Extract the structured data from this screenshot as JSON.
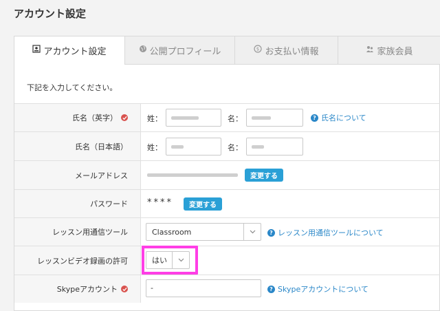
{
  "page_title": "アカウント設定",
  "tabs": [
    {
      "label": "アカウント設定",
      "icon": "account-icon"
    },
    {
      "label": "公開プロフィール",
      "icon": "globe-icon"
    },
    {
      "label": "お支払い情報",
      "icon": "coin-icon"
    },
    {
      "label": "家族会員",
      "icon": "family-icon"
    }
  ],
  "intro": "下記を入力してください。",
  "rows": {
    "name_en": {
      "label": "氏名（英字）",
      "last_prefix": "姓：",
      "first_prefix": "名：",
      "help": "氏名について"
    },
    "name_jp": {
      "label": "氏名（日本語）",
      "last_prefix": "姓：",
      "first_prefix": "名："
    },
    "email": {
      "label": "メールアドレス",
      "change_button": "変更する"
    },
    "password": {
      "label": "パスワード",
      "mask": "****",
      "change_button": "変更する"
    },
    "tool": {
      "label": "レッスン用通信ツール",
      "value": "Classroom",
      "help": "レッスン用通信ツールについて"
    },
    "record": {
      "label": "レッスンビデオ録画の許可",
      "value": "はい"
    },
    "skype": {
      "label": "Skypeアカウント",
      "value": "-",
      "help": "Skypeアカウントについて"
    }
  },
  "colors": {
    "accent": "#2aa0d6",
    "link": "#2a87c8",
    "required": "#d9534f",
    "highlight": "#ff3ee6"
  }
}
